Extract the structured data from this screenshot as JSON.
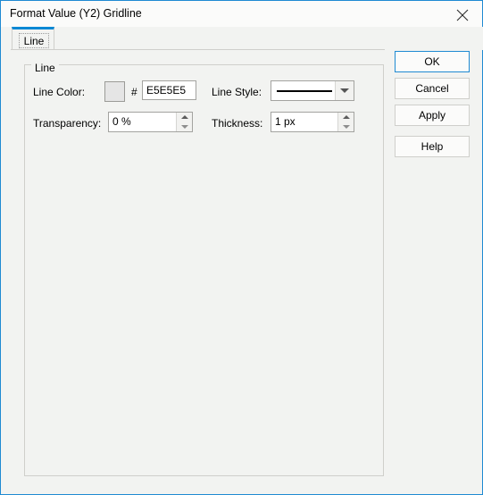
{
  "dialog": {
    "title": "Format Value (Y2) Gridline",
    "close_icon": "close-icon",
    "border_color": "#1f8ad2",
    "background_color": "#f2f3f1"
  },
  "tabs": [
    {
      "label": "Line",
      "selected": true
    }
  ],
  "group": {
    "legend": "Line"
  },
  "fields": {
    "line_color": {
      "label": "Line Color:",
      "swatch_color": "#E5E5E5",
      "hash": "#",
      "hex_value": "E5E5E5"
    },
    "transparency": {
      "label": "Transparency:",
      "value": "0 %"
    },
    "line_style": {
      "label": "Line Style:",
      "selected": "solid-line",
      "arrow_icon": "chevron-down-icon"
    },
    "thickness": {
      "label": "Thickness:",
      "value": "1 px"
    }
  },
  "buttons": {
    "ok": "OK",
    "cancel": "Cancel",
    "apply": "Apply",
    "help": "Help"
  }
}
